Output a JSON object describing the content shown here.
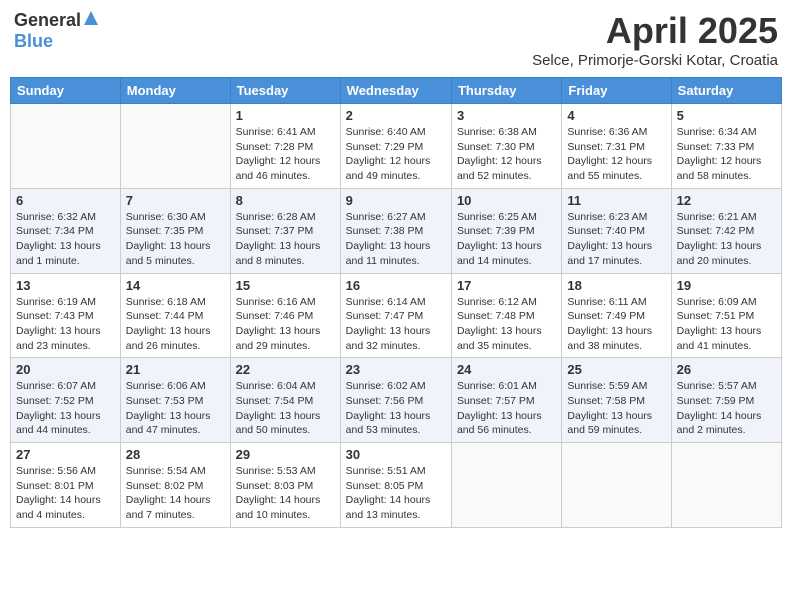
{
  "header": {
    "logo_general": "General",
    "logo_blue": "Blue",
    "title": "April 2025",
    "location": "Selce, Primorje-Gorski Kotar, Croatia"
  },
  "weekdays": [
    "Sunday",
    "Monday",
    "Tuesday",
    "Wednesday",
    "Thursday",
    "Friday",
    "Saturday"
  ],
  "weeks": [
    [
      {
        "day": "",
        "info": ""
      },
      {
        "day": "",
        "info": ""
      },
      {
        "day": "1",
        "info": "Sunrise: 6:41 AM\nSunset: 7:28 PM\nDaylight: 12 hours\nand 46 minutes."
      },
      {
        "day": "2",
        "info": "Sunrise: 6:40 AM\nSunset: 7:29 PM\nDaylight: 12 hours\nand 49 minutes."
      },
      {
        "day": "3",
        "info": "Sunrise: 6:38 AM\nSunset: 7:30 PM\nDaylight: 12 hours\nand 52 minutes."
      },
      {
        "day": "4",
        "info": "Sunrise: 6:36 AM\nSunset: 7:31 PM\nDaylight: 12 hours\nand 55 minutes."
      },
      {
        "day": "5",
        "info": "Sunrise: 6:34 AM\nSunset: 7:33 PM\nDaylight: 12 hours\nand 58 minutes."
      }
    ],
    [
      {
        "day": "6",
        "info": "Sunrise: 6:32 AM\nSunset: 7:34 PM\nDaylight: 13 hours\nand 1 minute."
      },
      {
        "day": "7",
        "info": "Sunrise: 6:30 AM\nSunset: 7:35 PM\nDaylight: 13 hours\nand 5 minutes."
      },
      {
        "day": "8",
        "info": "Sunrise: 6:28 AM\nSunset: 7:37 PM\nDaylight: 13 hours\nand 8 minutes."
      },
      {
        "day": "9",
        "info": "Sunrise: 6:27 AM\nSunset: 7:38 PM\nDaylight: 13 hours\nand 11 minutes."
      },
      {
        "day": "10",
        "info": "Sunrise: 6:25 AM\nSunset: 7:39 PM\nDaylight: 13 hours\nand 14 minutes."
      },
      {
        "day": "11",
        "info": "Sunrise: 6:23 AM\nSunset: 7:40 PM\nDaylight: 13 hours\nand 17 minutes."
      },
      {
        "day": "12",
        "info": "Sunrise: 6:21 AM\nSunset: 7:42 PM\nDaylight: 13 hours\nand 20 minutes."
      }
    ],
    [
      {
        "day": "13",
        "info": "Sunrise: 6:19 AM\nSunset: 7:43 PM\nDaylight: 13 hours\nand 23 minutes."
      },
      {
        "day": "14",
        "info": "Sunrise: 6:18 AM\nSunset: 7:44 PM\nDaylight: 13 hours\nand 26 minutes."
      },
      {
        "day": "15",
        "info": "Sunrise: 6:16 AM\nSunset: 7:46 PM\nDaylight: 13 hours\nand 29 minutes."
      },
      {
        "day": "16",
        "info": "Sunrise: 6:14 AM\nSunset: 7:47 PM\nDaylight: 13 hours\nand 32 minutes."
      },
      {
        "day": "17",
        "info": "Sunrise: 6:12 AM\nSunset: 7:48 PM\nDaylight: 13 hours\nand 35 minutes."
      },
      {
        "day": "18",
        "info": "Sunrise: 6:11 AM\nSunset: 7:49 PM\nDaylight: 13 hours\nand 38 minutes."
      },
      {
        "day": "19",
        "info": "Sunrise: 6:09 AM\nSunset: 7:51 PM\nDaylight: 13 hours\nand 41 minutes."
      }
    ],
    [
      {
        "day": "20",
        "info": "Sunrise: 6:07 AM\nSunset: 7:52 PM\nDaylight: 13 hours\nand 44 minutes."
      },
      {
        "day": "21",
        "info": "Sunrise: 6:06 AM\nSunset: 7:53 PM\nDaylight: 13 hours\nand 47 minutes."
      },
      {
        "day": "22",
        "info": "Sunrise: 6:04 AM\nSunset: 7:54 PM\nDaylight: 13 hours\nand 50 minutes."
      },
      {
        "day": "23",
        "info": "Sunrise: 6:02 AM\nSunset: 7:56 PM\nDaylight: 13 hours\nand 53 minutes."
      },
      {
        "day": "24",
        "info": "Sunrise: 6:01 AM\nSunset: 7:57 PM\nDaylight: 13 hours\nand 56 minutes."
      },
      {
        "day": "25",
        "info": "Sunrise: 5:59 AM\nSunset: 7:58 PM\nDaylight: 13 hours\nand 59 minutes."
      },
      {
        "day": "26",
        "info": "Sunrise: 5:57 AM\nSunset: 7:59 PM\nDaylight: 14 hours\nand 2 minutes."
      }
    ],
    [
      {
        "day": "27",
        "info": "Sunrise: 5:56 AM\nSunset: 8:01 PM\nDaylight: 14 hours\nand 4 minutes."
      },
      {
        "day": "28",
        "info": "Sunrise: 5:54 AM\nSunset: 8:02 PM\nDaylight: 14 hours\nand 7 minutes."
      },
      {
        "day": "29",
        "info": "Sunrise: 5:53 AM\nSunset: 8:03 PM\nDaylight: 14 hours\nand 10 minutes."
      },
      {
        "day": "30",
        "info": "Sunrise: 5:51 AM\nSunset: 8:05 PM\nDaylight: 14 hours\nand 13 minutes."
      },
      {
        "day": "",
        "info": ""
      },
      {
        "day": "",
        "info": ""
      },
      {
        "day": "",
        "info": ""
      }
    ]
  ]
}
